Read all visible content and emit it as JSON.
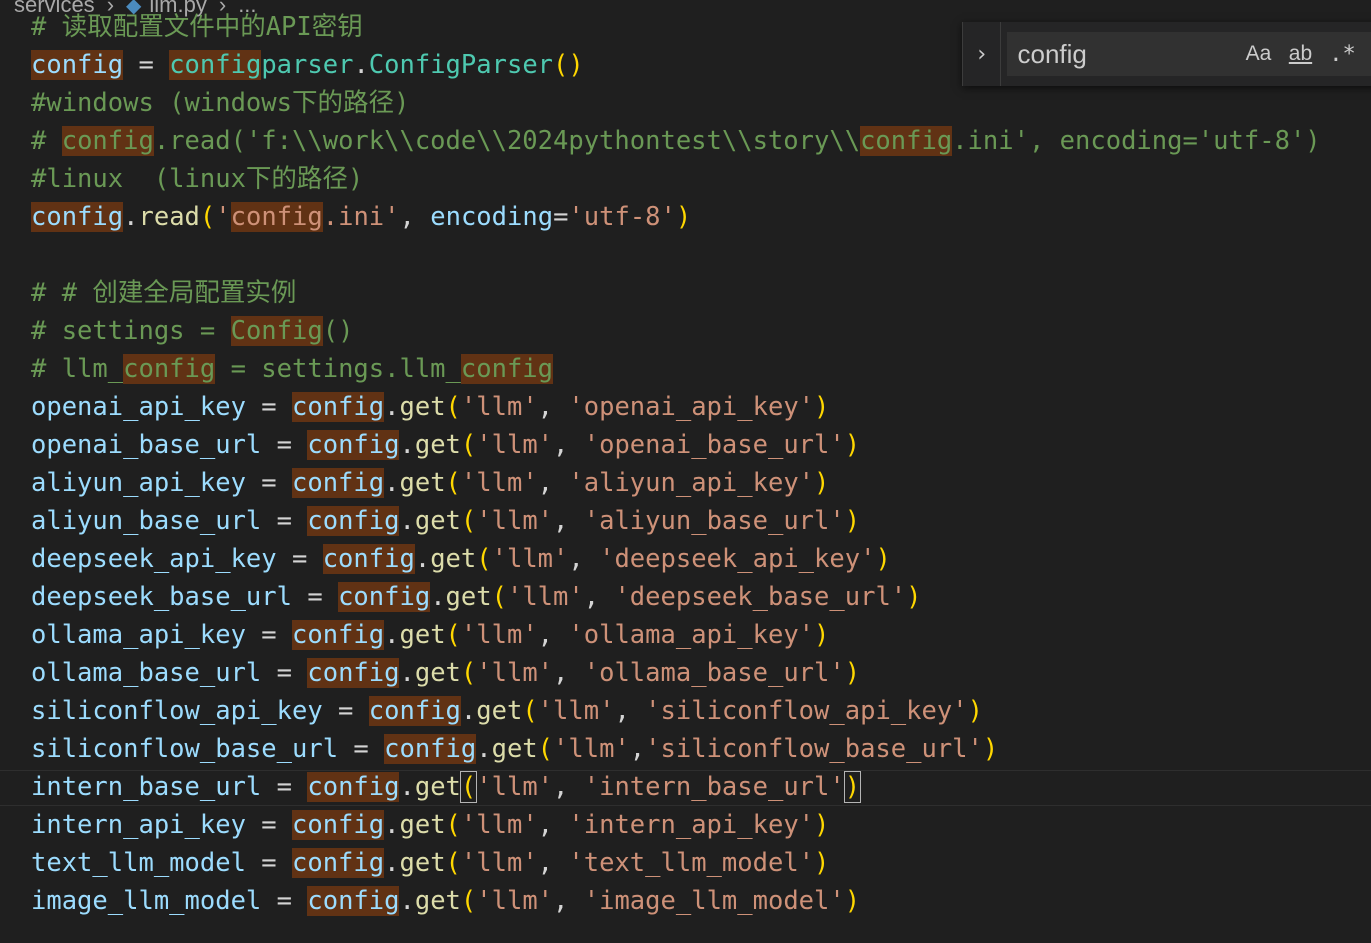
{
  "breadcrumb": {
    "folder": "services",
    "file": "llm.py",
    "trail": "..."
  },
  "find": {
    "query": "config",
    "match_case_label": "Aa",
    "whole_word_label": "ab",
    "regex_label": ".*"
  },
  "code": {
    "lines": [
      [
        [
          "tok-comment",
          "# 读取配置文件中的API密钥"
        ]
      ],
      [
        [
          "tok-var match",
          "config"
        ],
        [
          "tok-op",
          " = "
        ],
        [
          "tok-class match",
          "config"
        ],
        [
          "tok-class",
          "parser"
        ],
        [
          "tok-punct",
          "."
        ],
        [
          "tok-class",
          "ConfigParser"
        ],
        [
          "tok-paren",
          "()"
        ]
      ],
      [
        [
          "tok-comment",
          "#windows (windows下的路径)"
        ]
      ],
      [
        [
          "tok-comment",
          "# "
        ],
        [
          "tok-comment match",
          "config"
        ],
        [
          "tok-comment",
          ".read('f:\\\\work\\\\code\\\\2024pythontest\\\\story\\\\"
        ],
        [
          "tok-comment match",
          "config"
        ],
        [
          "tok-comment",
          ".ini', encoding='utf-8')"
        ]
      ],
      [
        [
          "tok-comment",
          "#linux  (linux下的路径)"
        ]
      ],
      [
        [
          "tok-var match",
          "config"
        ],
        [
          "tok-punct",
          "."
        ],
        [
          "tok-func",
          "read"
        ],
        [
          "tok-paren",
          "("
        ],
        [
          "tok-str",
          "'"
        ],
        [
          "tok-str match",
          "config"
        ],
        [
          "tok-str",
          ".ini'"
        ],
        [
          "tok-punct",
          ", "
        ],
        [
          "tok-var",
          "encoding"
        ],
        [
          "tok-op",
          "="
        ],
        [
          "tok-str",
          "'utf-8'"
        ],
        [
          "tok-paren",
          ")"
        ]
      ],
      [],
      [
        [
          "tok-comment",
          "# # 创建全局配置实例"
        ]
      ],
      [
        [
          "tok-comment",
          "# settings = "
        ],
        [
          "tok-comment match",
          "Config"
        ],
        [
          "tok-comment",
          "()"
        ]
      ],
      [
        [
          "tok-comment",
          "# llm_"
        ],
        [
          "tok-comment match",
          "config"
        ],
        [
          "tok-comment",
          " = settings.llm_"
        ],
        [
          "tok-comment match",
          "config"
        ]
      ],
      [
        [
          "tok-var",
          "openai_api_key"
        ],
        [
          "tok-op",
          " = "
        ],
        [
          "tok-var match",
          "config"
        ],
        [
          "tok-punct",
          "."
        ],
        [
          "tok-func",
          "get"
        ],
        [
          "tok-paren",
          "("
        ],
        [
          "tok-str",
          "'llm'"
        ],
        [
          "tok-punct",
          ", "
        ],
        [
          "tok-str",
          "'openai_api_key'"
        ],
        [
          "tok-paren",
          ")"
        ]
      ],
      [
        [
          "tok-var",
          "openai_base_url"
        ],
        [
          "tok-op",
          " = "
        ],
        [
          "tok-var match",
          "config"
        ],
        [
          "tok-punct",
          "."
        ],
        [
          "tok-func",
          "get"
        ],
        [
          "tok-paren",
          "("
        ],
        [
          "tok-str",
          "'llm'"
        ],
        [
          "tok-punct",
          ", "
        ],
        [
          "tok-str",
          "'openai_base_url'"
        ],
        [
          "tok-paren",
          ")"
        ]
      ],
      [
        [
          "tok-var",
          "aliyun_api_key"
        ],
        [
          "tok-op",
          " = "
        ],
        [
          "tok-var match",
          "config"
        ],
        [
          "tok-punct",
          "."
        ],
        [
          "tok-func",
          "get"
        ],
        [
          "tok-paren",
          "("
        ],
        [
          "tok-str",
          "'llm'"
        ],
        [
          "tok-punct",
          ", "
        ],
        [
          "tok-str",
          "'aliyun_api_key'"
        ],
        [
          "tok-paren",
          ")"
        ]
      ],
      [
        [
          "tok-var",
          "aliyun_base_url"
        ],
        [
          "tok-op",
          " = "
        ],
        [
          "tok-var match",
          "config"
        ],
        [
          "tok-punct",
          "."
        ],
        [
          "tok-func",
          "get"
        ],
        [
          "tok-paren",
          "("
        ],
        [
          "tok-str",
          "'llm'"
        ],
        [
          "tok-punct",
          ", "
        ],
        [
          "tok-str",
          "'aliyun_base_url'"
        ],
        [
          "tok-paren",
          ")"
        ]
      ],
      [
        [
          "tok-var",
          "deepseek_api_key"
        ],
        [
          "tok-op",
          " = "
        ],
        [
          "tok-var match",
          "config"
        ],
        [
          "tok-punct",
          "."
        ],
        [
          "tok-func",
          "get"
        ],
        [
          "tok-paren",
          "("
        ],
        [
          "tok-str",
          "'llm'"
        ],
        [
          "tok-punct",
          ", "
        ],
        [
          "tok-str",
          "'deepseek_api_key'"
        ],
        [
          "tok-paren",
          ")"
        ]
      ],
      [
        [
          "tok-var",
          "deepseek_base_url"
        ],
        [
          "tok-op",
          " = "
        ],
        [
          "tok-var match",
          "config"
        ],
        [
          "tok-punct",
          "."
        ],
        [
          "tok-func",
          "get"
        ],
        [
          "tok-paren",
          "("
        ],
        [
          "tok-str",
          "'llm'"
        ],
        [
          "tok-punct",
          ", "
        ],
        [
          "tok-str",
          "'deepseek_base_url'"
        ],
        [
          "tok-paren",
          ")"
        ]
      ],
      [
        [
          "tok-var",
          "ollama_api_key"
        ],
        [
          "tok-op",
          " = "
        ],
        [
          "tok-var match",
          "config"
        ],
        [
          "tok-punct",
          "."
        ],
        [
          "tok-func",
          "get"
        ],
        [
          "tok-paren",
          "("
        ],
        [
          "tok-str",
          "'llm'"
        ],
        [
          "tok-punct",
          ", "
        ],
        [
          "tok-str",
          "'ollama_api_key'"
        ],
        [
          "tok-paren",
          ")"
        ]
      ],
      [
        [
          "tok-var",
          "ollama_base_url"
        ],
        [
          "tok-op",
          " = "
        ],
        [
          "tok-var match",
          "config"
        ],
        [
          "tok-punct",
          "."
        ],
        [
          "tok-func",
          "get"
        ],
        [
          "tok-paren",
          "("
        ],
        [
          "tok-str",
          "'llm'"
        ],
        [
          "tok-punct",
          ", "
        ],
        [
          "tok-str",
          "'ollama_base_url'"
        ],
        [
          "tok-paren",
          ")"
        ]
      ],
      [
        [
          "tok-var",
          "siliconflow_api_key"
        ],
        [
          "tok-op",
          " = "
        ],
        [
          "tok-var match",
          "config"
        ],
        [
          "tok-punct",
          "."
        ],
        [
          "tok-func",
          "get"
        ],
        [
          "tok-paren",
          "("
        ],
        [
          "tok-str",
          "'llm'"
        ],
        [
          "tok-punct",
          ", "
        ],
        [
          "tok-str",
          "'siliconflow_api_key'"
        ],
        [
          "tok-paren",
          ")"
        ]
      ],
      [
        [
          "tok-var",
          "siliconflow_base_url"
        ],
        [
          "tok-op",
          " = "
        ],
        [
          "tok-var match",
          "config"
        ],
        [
          "tok-punct",
          "."
        ],
        [
          "tok-func",
          "get"
        ],
        [
          "tok-paren",
          "("
        ],
        [
          "tok-str",
          "'llm'"
        ],
        [
          "tok-punct",
          ","
        ],
        [
          "tok-str",
          "'siliconflow_base_url'"
        ],
        [
          "tok-paren",
          ")"
        ]
      ],
      [
        [
          "tok-var",
          "intern_base_url"
        ],
        [
          "tok-op",
          " = "
        ],
        [
          "tok-var match",
          "config"
        ],
        [
          "tok-punct",
          "."
        ],
        [
          "tok-func",
          "get"
        ],
        [
          "tok-paren bracket-box",
          "("
        ],
        [
          "tok-str",
          "'llm'"
        ],
        [
          "tok-punct",
          ", "
        ],
        [
          "tok-str",
          "'intern_base_url'"
        ],
        [
          "tok-paren bracket-box",
          ")"
        ]
      ],
      [
        [
          "tok-var",
          "intern_api_key"
        ],
        [
          "tok-op",
          " = "
        ],
        [
          "tok-var match",
          "config"
        ],
        [
          "tok-punct",
          "."
        ],
        [
          "tok-func",
          "get"
        ],
        [
          "tok-paren",
          "("
        ],
        [
          "tok-str",
          "'llm'"
        ],
        [
          "tok-punct",
          ", "
        ],
        [
          "tok-str",
          "'intern_api_key'"
        ],
        [
          "tok-paren",
          ")"
        ]
      ],
      [
        [
          "tok-var",
          "text_llm_model"
        ],
        [
          "tok-op",
          " = "
        ],
        [
          "tok-var match",
          "config"
        ],
        [
          "tok-punct",
          "."
        ],
        [
          "tok-func",
          "get"
        ],
        [
          "tok-paren",
          "("
        ],
        [
          "tok-str",
          "'llm'"
        ],
        [
          "tok-punct",
          ", "
        ],
        [
          "tok-str",
          "'text_llm_model'"
        ],
        [
          "tok-paren",
          ")"
        ]
      ],
      [
        [
          "tok-var",
          "image_llm_model"
        ],
        [
          "tok-op",
          " = "
        ],
        [
          "tok-var match",
          "config"
        ],
        [
          "tok-punct",
          "."
        ],
        [
          "tok-func",
          "get"
        ],
        [
          "tok-paren",
          "("
        ],
        [
          "tok-str",
          "'llm'"
        ],
        [
          "tok-punct",
          ", "
        ],
        [
          "tok-str",
          "'image_llm_model'"
        ],
        [
          "tok-paren",
          ")"
        ]
      ]
    ]
  }
}
